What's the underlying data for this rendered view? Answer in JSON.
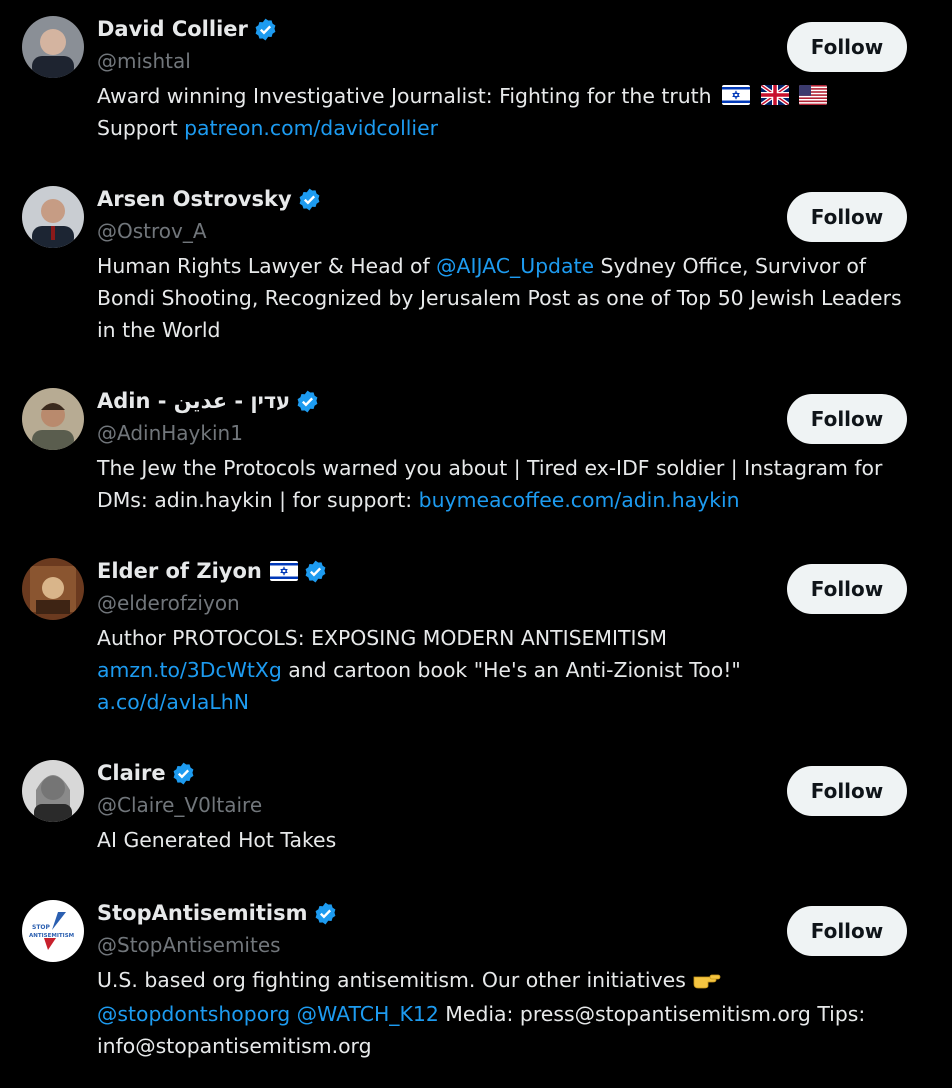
{
  "follow_label": "Follow",
  "colors": {
    "link": "#1d9bf0",
    "verified": "#1d9bf0",
    "handle": "#71767b"
  },
  "users": [
    {
      "name": "David Collier",
      "handle": "@mishtal",
      "bio_line1": "Award winning Investigative Journalist: Fighting for the truth",
      "bio_support": "Support ",
      "bio_link": "patreon.com/davidcollier"
    },
    {
      "name": "Arsen Ostrovsky",
      "handle": "@Ostrov_A",
      "bio_pre": "Human Rights Lawyer & Head of ",
      "bio_mention": "@AIJAC_Update",
      "bio_post": " Sydney Office, Survivor of Bondi Shooting, Recognized by Jerusalem Post as one of Top 50 Jewish Leaders in the World"
    },
    {
      "name": "Adin - עדין - عدين",
      "handle": "@AdinHaykin1",
      "bio_pre": "The Jew the Protocols warned you about | Tired ex-IDF soldier | Instagram for DMs: adin.haykin | for support: ",
      "bio_link": "buymeacoffee.com/adin.haykin"
    },
    {
      "name": "Elder of Ziyon",
      "handle": "@elderofziyon",
      "bio_pre": "Author PROTOCOLS: EXPOSING MODERN ANTISEMITISM",
      "bio_link1": "amzn.to/3DcWtXg",
      "bio_mid": " and cartoon book \"He's an Anti-Zionist Too!\"",
      "bio_link2": "a.co/d/avIaLhN"
    },
    {
      "name": "Claire",
      "handle": "@Claire_V0ltaire",
      "bio": "AI Generated Hot Takes"
    },
    {
      "name": "StopAntisemitism",
      "handle": "@StopAntisemites",
      "bio_pre": "U.S. based org fighting antisemitism. Our other initiatives",
      "bio_mention1": "@stopdontshoporg",
      "bio_mention2": "@WATCH_K12",
      "bio_post": " Media: press@stopantisemitism.org Tips: info@stopantisemitism.org",
      "avatar_text_top": "STOP",
      "avatar_text_bottom": "ANTISEMITISM"
    }
  ],
  "icons": [
    "verified-badge-icon",
    "israel-flag-icon",
    "uk-flag-icon",
    "us-flag-icon",
    "pointing-hand-icon"
  ]
}
